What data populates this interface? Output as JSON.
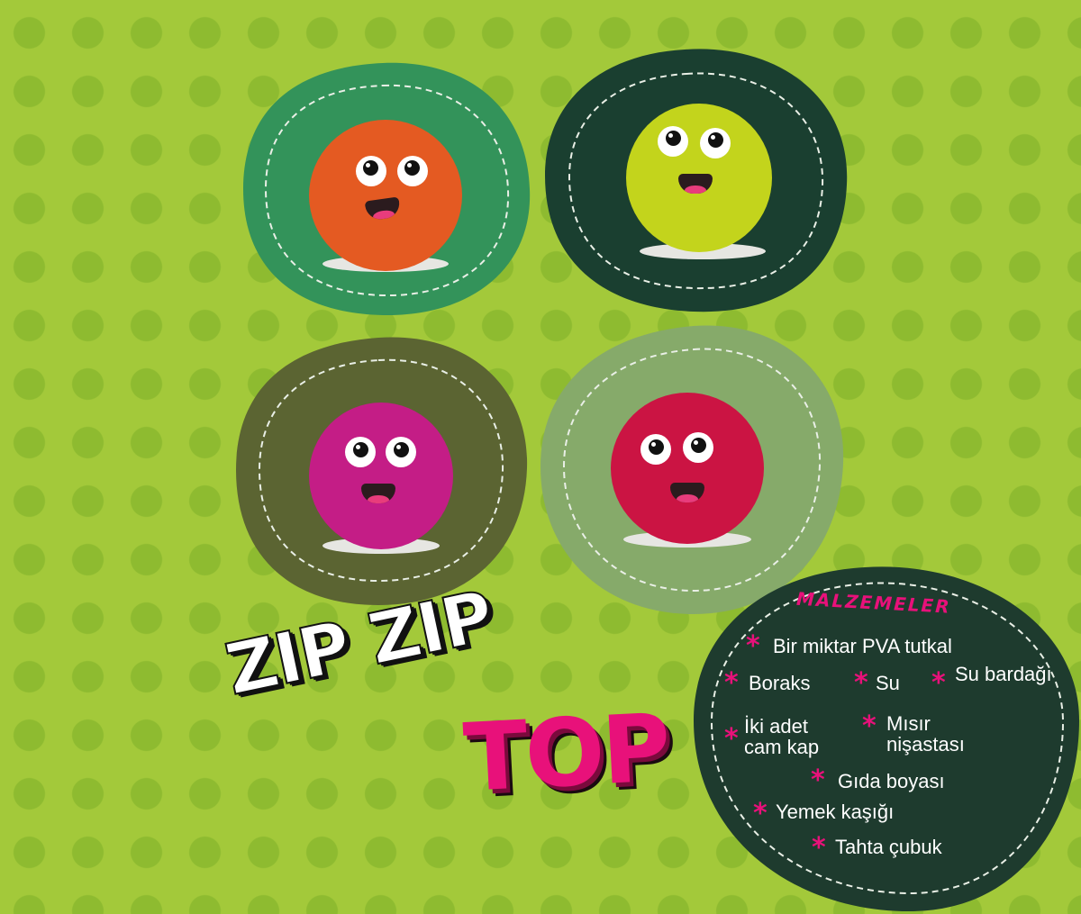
{
  "title": {
    "line1": "ZIP ZIP",
    "line2": "TOP"
  },
  "ingredients": {
    "heading": "MALZEMELER",
    "items": [
      "Bir miktar PVA tutkal",
      "Boraks",
      "Su",
      "Su bardağı",
      "İki adet cam kap",
      "Mısır nişastası",
      "Gıda boyası",
      "Yemek kaşığı",
      "Tahta çubuk"
    ]
  },
  "balls": [
    {
      "name": "orange-ball",
      "color": "#e45a22",
      "backdrop": "#33935a"
    },
    {
      "name": "yellow-ball",
      "color": "#c3d41c",
      "backdrop": "#1a3f30"
    },
    {
      "name": "magenta-ball",
      "color": "#c41d86",
      "backdrop": "#5b6432"
    },
    {
      "name": "red-ball",
      "color": "#cb1443",
      "backdrop": "#86aa6a"
    }
  ],
  "colors": {
    "background": "#a3c93a",
    "dots": "#8ebb30",
    "accent_pink": "#e8117a",
    "panel": "#1e3b2e"
  }
}
